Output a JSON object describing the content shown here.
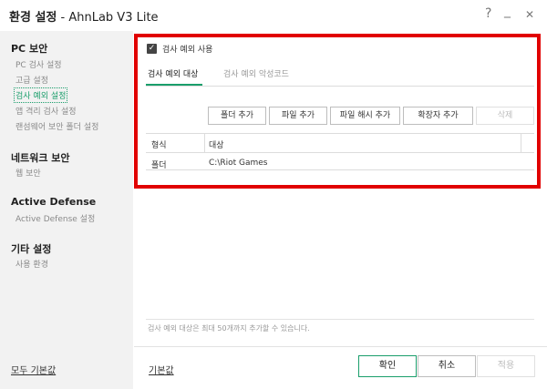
{
  "window": {
    "title_bold": "환경 설정",
    "title_rest": " - AhnLab V3 Lite",
    "help_icon": "?",
    "minimize_icon": "_",
    "close_icon": "✕"
  },
  "sidebar": {
    "sections": [
      {
        "label": "PC 보안",
        "items": [
          "PC 검사 설정",
          "고급 설정",
          "검사 예외 설정",
          "앱 격리 검사 설정",
          "랜섬웨어 보안 폴더 설정"
        ]
      },
      {
        "label": "네트워크 보안",
        "items": [
          "웹 보안"
        ]
      },
      {
        "label": "Active Defense",
        "items": [
          "Active Defense 설정"
        ]
      },
      {
        "label": "기타 설정",
        "items": [
          "사용 환경"
        ]
      }
    ],
    "active_item": "검사 예외 설정",
    "reset_all_label": "모두 기본값"
  },
  "main": {
    "enable_checkbox_label": "검사 예외 사용",
    "enable_checked": true,
    "tabs": [
      {
        "label": "검사 예외 대상",
        "active": true
      },
      {
        "label": "검사 예외 악성코드",
        "active": false
      }
    ],
    "toolbar": {
      "add_folder": "폴더 추가",
      "add_file": "파일 추가",
      "add_file_hash": "파일 해시 추가",
      "add_extension": "확장자 추가",
      "delete": "삭제"
    },
    "table": {
      "columns": [
        "형식",
        "대상"
      ],
      "rows": [
        [
          "폴더",
          "C:\\Riot Games"
        ]
      ]
    },
    "note": "검사 예외 대상은 최대 50개까지 추가할 수 있습니다."
  },
  "footer": {
    "default_label": "기본값",
    "ok_label": "확인",
    "cancel_label": "취소",
    "apply_label": "적용"
  },
  "colors": {
    "accent": "#1a9e6b",
    "highlight_border": "#e10000",
    "sidebar_bg": "#f2f2f2"
  }
}
